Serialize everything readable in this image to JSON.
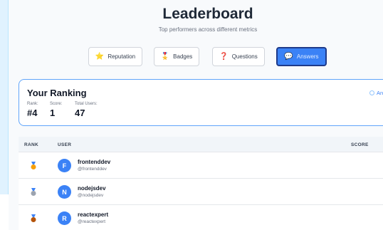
{
  "header": {
    "title": "Leaderboard",
    "subtitle": "Top performers across different metrics"
  },
  "tabs": [
    {
      "label": "Reputation",
      "icon": "star-icon",
      "glyph": "⭐",
      "active": false
    },
    {
      "label": "Badges",
      "icon": "medal-icon",
      "glyph": "🎖️",
      "active": false
    },
    {
      "label": "Questions",
      "icon": "question-icon",
      "glyph": "❓",
      "active": false
    },
    {
      "label": "Answers",
      "icon": "speech-bubble-icon",
      "glyph": "💬",
      "active": true
    }
  ],
  "your_ranking": {
    "title": "Your Ranking",
    "rank_label": "Rank:",
    "rank_value": "#4",
    "score_label": "Score:",
    "score_value": "1",
    "total_label": "Total Users:",
    "total_value": "47",
    "link_label": "Answer"
  },
  "table": {
    "columns": {
      "rank": "RANK",
      "user": "USER",
      "score": "SCORE"
    },
    "rows": [
      {
        "initial": "F",
        "name": "frontenddev",
        "handle": "@frontenddev",
        "medal": "gold-medal-icon"
      },
      {
        "initial": "N",
        "name": "nodejsdev",
        "handle": "@nodejsdev",
        "medal": "silver-medal-icon"
      },
      {
        "initial": "R",
        "name": "reactexpert",
        "handle": "@reactexpert",
        "medal": "bronze-medal-icon"
      }
    ]
  },
  "colors": {
    "accent": "#3b82f6",
    "gold": "#f59e0b",
    "silver": "#9ca3af",
    "bronze": "#b45309"
  }
}
